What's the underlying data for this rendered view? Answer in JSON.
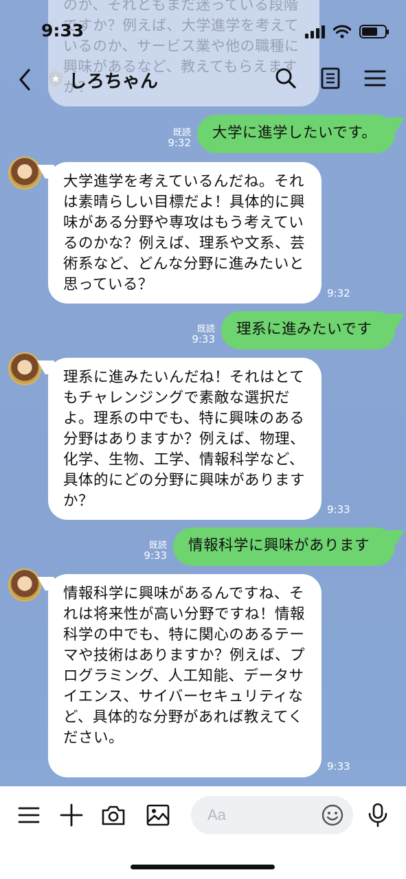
{
  "status": {
    "time": "9:33"
  },
  "header": {
    "title": "しろちゃん"
  },
  "ghost_text": "のか、それともまだ迷っている段階ですか？例えば、大学進学を考えているのか、サービス業や他の職種に興味があるなど、教えてもらえますか？",
  "messages": [
    {
      "side": "out",
      "text": "大学に進学したいです。",
      "read": "既読",
      "time": "9:32"
    },
    {
      "side": "in",
      "text": "大学進学を考えているんだね。それは素晴らしい目標だよ！具体的に興味がある分野や専攻はもう考えているのかな？例えば、理系や文系、芸術系など、どんな分野に進みたいと思っている？",
      "time": "9:32"
    },
    {
      "side": "out",
      "text": "理系に進みたいです",
      "read": "既読",
      "time": "9:33"
    },
    {
      "side": "in",
      "text": "理系に進みたいんだね！それはとてもチャレンジングで素敵な選択だよ。理系の中でも、特に興味のある分野はありますか？例えば、物理、化学、生物、工学、情報科学など、具体的にどの分野に興味がありますか？",
      "time": "9:33"
    },
    {
      "side": "out",
      "text": "情報科学に興味があります",
      "read": "既読",
      "time": "9:33"
    },
    {
      "side": "in",
      "text": "情報科学に興味があるんですね、それは将来性が高い分野ですね！情報科学の中でも、特に関心のあるテーマや技術はありますか？例えば、プログラミング、人工知能、データサイエンス、サイバーセキュリティなど、具体的な分野があれば教えてください。",
      "time": "9:33"
    }
  ],
  "input": {
    "placeholder": "Aa"
  },
  "icons": {
    "back": "back-icon",
    "search": "search-icon",
    "notes": "notes-icon",
    "menu": "menu-icon",
    "more": "hamburger-icon",
    "add": "plus-icon",
    "camera": "camera-icon",
    "image": "image-icon",
    "emoji": "emoji-icon",
    "mic": "microphone-icon"
  }
}
